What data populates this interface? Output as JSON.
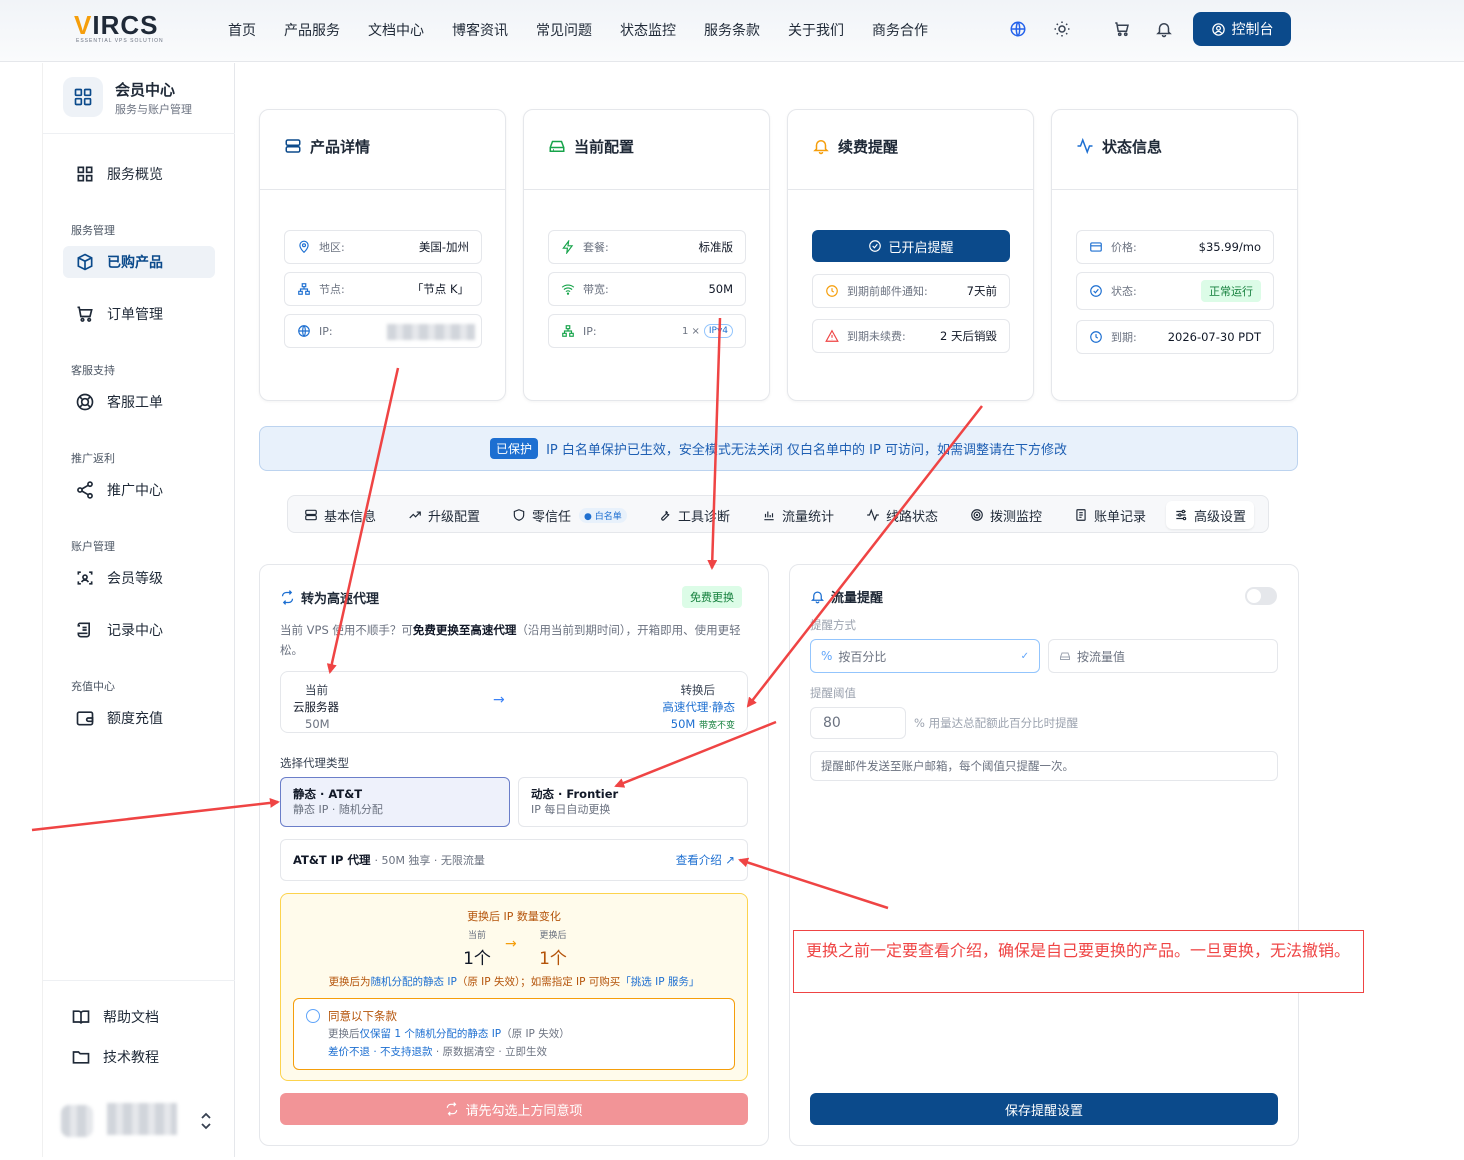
{
  "header": {
    "logo": "VIRCS",
    "logo_tagline": "ESSENTIAL VPS SOLUTION",
    "nav": [
      "首页",
      "产品服务",
      "文档中心",
      "博客资讯",
      "常见问题",
      "状态监控",
      "服务条款",
      "关于我们",
      "商务合作"
    ],
    "console_label": "控制台"
  },
  "sidebar": {
    "title": "会员中心",
    "subtitle": "服务与账户管理",
    "overview": "服务概览",
    "groups": [
      "服务管理",
      "客服支持",
      "推广返利",
      "账户管理",
      "充值中心"
    ],
    "items": [
      "已购产品",
      "订单管理",
      "客服工单",
      "推广中心",
      "会员等级",
      "记录中心",
      "额度充值"
    ],
    "help": "帮助文档",
    "tutorial": "技术教程"
  },
  "cards": {
    "product": {
      "title": "产品详情",
      "rows": [
        {
          "label": "地区:",
          "value": "美国-加州"
        },
        {
          "label": "节点:",
          "value": "「节点 K」"
        },
        {
          "label": "IP:",
          "value": ""
        }
      ]
    },
    "config": {
      "title": "当前配置",
      "rows": [
        {
          "label": "套餐:",
          "value": "标准版"
        },
        {
          "label": "带宽:",
          "value": "50M"
        },
        {
          "label": "IP:",
          "value": "1 ×",
          "badge": "IPv4"
        }
      ]
    },
    "renew": {
      "title": "续费提醒",
      "button": "已开启提醒",
      "rows": [
        {
          "label": "到期前邮件通知:",
          "value": "7天前"
        },
        {
          "label": "到期未续费:",
          "value": "2 天后销毁"
        }
      ]
    },
    "status": {
      "title": "状态信息",
      "rows": [
        {
          "label": "价格:",
          "value": "$35.99/mo"
        },
        {
          "label": "状态:",
          "value": "正常运行"
        },
        {
          "label": "到期:",
          "value": "2026-07-30 PDT"
        }
      ]
    }
  },
  "banner": {
    "badge": "已保护",
    "text": "IP 白名单保护已生效，安全模式无法关闭  仅白名单中的 IP 可访问，如需调整请在下方修改"
  },
  "tabs": [
    {
      "label": "基本信息"
    },
    {
      "label": "升级配置"
    },
    {
      "label": "零信任",
      "tag": "白名单"
    },
    {
      "label": "工具诊断"
    },
    {
      "label": "流量统计"
    },
    {
      "label": "线路状态"
    },
    {
      "label": "拨测监控"
    },
    {
      "label": "账单记录"
    },
    {
      "label": "高级设置"
    }
  ],
  "convert": {
    "title": "转为高速代理",
    "free_badge": "免费更换",
    "desc_pre": "当前 VPS 使用不顺手？可",
    "desc_bold": "免费更换至高速代理",
    "desc_post": "（沿用当前到期时间），开箱即用、使用更轻松。",
    "current_label": "当前",
    "current_name": "云服务器",
    "current_bw": "50M",
    "after_label": "转换后",
    "after_name": "高速代理·静态",
    "after_bw": "50M",
    "after_bw_note": "带宽不变",
    "select_label": "选择代理类型",
    "options": [
      {
        "title": "静态 · AT&T",
        "sub": "静态 IP · 随机分配"
      },
      {
        "title": "动态 · Frontier",
        "sub": "IP 每日自动更换"
      }
    ],
    "product_name": "AT&T IP 代理",
    "product_desc": "· 50M 独享 · 无限流量",
    "product_link": "查看介绍",
    "ip_title": "更换后 IP 数量变化",
    "ip_current_label": "当前",
    "ip_current": "1个",
    "ip_after_label": "更换后",
    "ip_after": "1个",
    "ip_note_pre": "更换后为",
    "ip_note_link": "随机分配的静态 IP",
    "ip_note_mid": "（原 IP 失效）；如需指定 IP 可购买",
    "ip_note_link2": "「挑选 IP 服务」",
    "agree_title": "同意以下条款",
    "agree_line1_pre": "更换后",
    "agree_line1_link": "仅保留 1 个随机分配的静态 IP",
    "agree_line1_post": "（原 IP 失效）",
    "agree_line2_link": "差价不退 · 不支持退款",
    "agree_line2_post": " · 原数据清空 · 立即生效",
    "submit": "请先勾选上方同意项"
  },
  "traffic": {
    "title": "流量提醒",
    "mode_label": "提醒方式",
    "mode_percent": "按百分比",
    "mode_value": "按流量值",
    "threshold_label": "提醒阈值",
    "threshold_value": "80",
    "threshold_note": "%  用量达总配额此百分比时提醒",
    "mail_note": "提醒邮件发送至账户邮箱，每个阈值只提醒一次。",
    "save": "保存提醒设置"
  },
  "annotation": "更换之前一定要查看介绍，确保是自己要更换的产品。一旦更换，无法撤销。",
  "colors": {
    "primary": "#0b4a8b",
    "accent_red": "#ef4444",
    "success": "#15803d"
  }
}
